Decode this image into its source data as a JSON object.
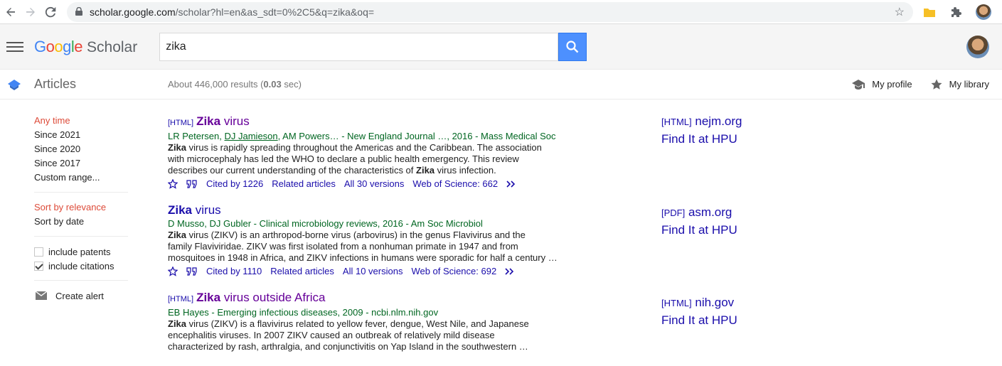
{
  "browser": {
    "url_host": "scholar.google.com",
    "url_path": "/scholar?hl=en&as_sdt=0%2C5&q=zika&oq="
  },
  "header": {
    "logo_google": "Google",
    "logo_scholar": "Scholar",
    "search_value": "zika"
  },
  "subheader": {
    "section": "Articles",
    "stats_prefix": "About 446,000 results (",
    "stats_time": "0.03",
    "stats_suffix": " sec)",
    "my_profile": "My profile",
    "my_library": "My library"
  },
  "sidebar": {
    "time": [
      "Any time",
      "Since 2021",
      "Since 2020",
      "Since 2017",
      "Custom range..."
    ],
    "sort": [
      "Sort by relevance",
      "Sort by date"
    ],
    "include_patents": "include patents",
    "include_citations": "include citations",
    "create_alert": "Create alert"
  },
  "results": [
    {
      "tag": "[HTML]",
      "title_hl": "Zika",
      "title_rest": " virus",
      "authors_pre": "LR Petersen, ",
      "authors_link": "DJ Jamieson",
      "authors_post": ", AM Powers… - New England Journal …, 2016 - Mass Medical Soc",
      "snippet": [
        [
          "Zika",
          " virus is rapidly spreading throughout the Americas and the Caribbean. The association"
        ],
        [
          "",
          "with microcephaly has led the WHO to declare a public health emergency. This review"
        ],
        [
          "",
          "describes our current understanding of the characteristics of "
        ],
        [
          "Zika",
          " virus infection."
        ]
      ],
      "cited": "Cited by 1226",
      "related": "Related articles",
      "versions": "All 30 versions",
      "wos": "Web of Science: 662",
      "side_tag": "[HTML]",
      "side_src": "nejm.org",
      "side_find": "Find It at HPU"
    },
    {
      "tag": "",
      "title_hl": "Zika",
      "title_rest": " virus",
      "authors_pre": "D Musso, DJ Gubler - Clinical microbiology reviews, 2016 - Am Soc Microbiol",
      "authors_link": "",
      "authors_post": "",
      "snippet": [
        [
          "Zika",
          " virus (ZIKV) is an arthropod-borne virus (arbovirus) in the genus Flavivirus and the"
        ],
        [
          "",
          "family Flaviviridae. ZIKV was first isolated from a nonhuman primate in 1947 and from"
        ],
        [
          "",
          "mosquitoes in 1948 in Africa, and ZIKV infections in humans were sporadic for half a century …"
        ]
      ],
      "cited": "Cited by 1110",
      "related": "Related articles",
      "versions": "All 10 versions",
      "wos": "Web of Science: 692",
      "side_tag": "[PDF]",
      "side_src": "asm.org",
      "side_find": "Find It at HPU"
    },
    {
      "tag": "[HTML]",
      "title_hl": "Zika",
      "title_rest": " virus outside Africa",
      "authors_pre": "EB Hayes - Emerging infectious diseases, 2009 - ncbi.nlm.nih.gov",
      "authors_link": "",
      "authors_post": "",
      "snippet": [
        [
          "Zika",
          " virus (ZIKV) is a flavivirus related to yellow fever, dengue, West Nile, and Japanese"
        ],
        [
          "",
          "encephalitis viruses. In 2007 ZIKV caused an outbreak of relatively mild disease"
        ],
        [
          "",
          "characterized by rash, arthralgia, and conjunctivitis on Yap Island in the southwestern …"
        ]
      ],
      "side_tag": "[HTML]",
      "side_src": "nih.gov",
      "side_find": "Find It at HPU"
    }
  ]
}
